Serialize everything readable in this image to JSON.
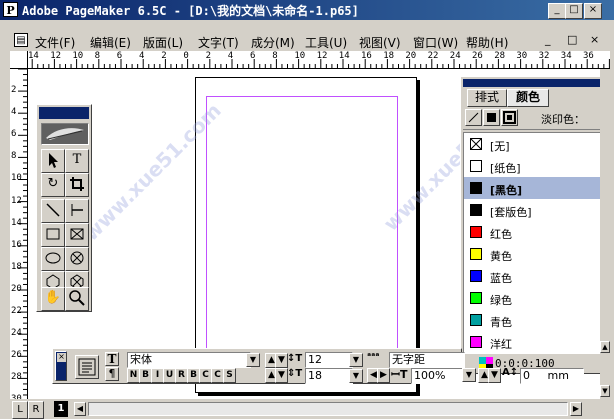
{
  "window": {
    "title": "Adobe PageMaker 6.5C - [D:\\我的文档\\未命名-1.p65]",
    "app_icon": "P",
    "buttons": [
      "_",
      "□",
      "×"
    ]
  },
  "menu": {
    "items": [
      "文件(F)",
      "编辑(E)",
      "版面(L)",
      "文字(T)",
      "成分(M)",
      "工具(U)",
      "视图(V)",
      "窗口(W)",
      "帮助(H)"
    ],
    "mdi_buttons": [
      "_",
      "□",
      "×"
    ]
  },
  "ruler": {
    "h_labels": [
      "14",
      "12",
      "10",
      "8",
      "6",
      "4",
      "2",
      "0",
      "2",
      "4",
      "6",
      "8",
      "10",
      "12",
      "14",
      "16",
      "18",
      "20",
      "22",
      "24",
      "26",
      "28",
      "30",
      "32",
      "34",
      "36"
    ],
    "v_labels": [
      "2",
      "4",
      "6",
      "8",
      "10",
      "12",
      "14",
      "16",
      "18",
      "20",
      "22",
      "24",
      "26",
      "28",
      "30"
    ]
  },
  "palette": {
    "tabs": [
      "排式",
      "颜色"
    ],
    "tint_label": "淡印色：",
    "swatches": [
      {
        "label": "[无]",
        "color": "#ffffff"
      },
      {
        "label": "[纸色]",
        "color": "#ffffff"
      },
      {
        "label": "[黑色]",
        "color": "#000000"
      },
      {
        "label": "[套版色]",
        "color": "#000000"
      },
      {
        "label": "红色",
        "color": "#ff0000"
      },
      {
        "label": "黄色",
        "color": "#ffff00"
      },
      {
        "label": "蓝色",
        "color": "#0000ff"
      },
      {
        "label": "绿色",
        "color": "#00ff00"
      },
      {
        "label": "青色",
        "color": "#00a0a0"
      },
      {
        "label": "洋红",
        "color": "#ff00ff"
      }
    ],
    "selected": "[黑色]",
    "cmyk": "0:0:0:100"
  },
  "control": {
    "font": "宋体",
    "size": "12",
    "leading": "18",
    "kerning": "无字距",
    "scale": "100%",
    "baseline": "0",
    "baseline_unit": "mm",
    "style_buttons": [
      "N",
      "B",
      "I",
      "U",
      "R",
      "B",
      "C",
      "C",
      "S"
    ]
  },
  "bottom": {
    "pages": [
      "L",
      "R",
      "1"
    ]
  },
  "watermark": "www.xue51.com"
}
